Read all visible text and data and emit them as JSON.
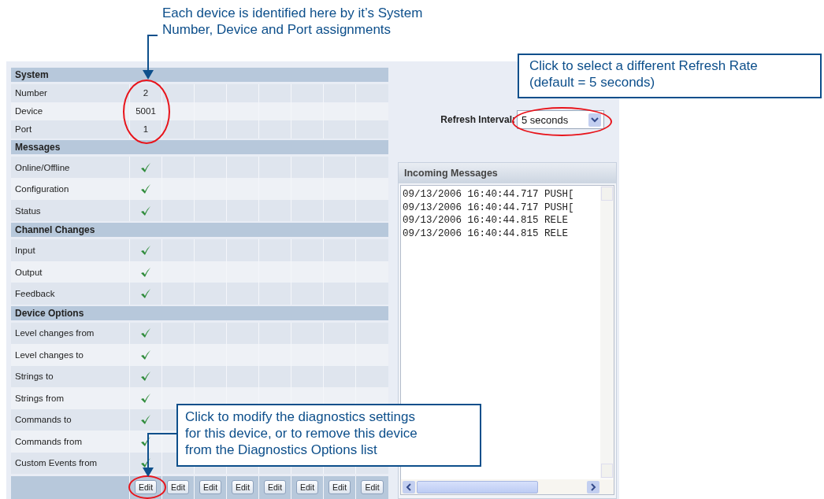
{
  "system": {
    "title": "System",
    "rows": [
      {
        "label": "Number",
        "value": "2"
      },
      {
        "label": "Device",
        "value": "5001"
      },
      {
        "label": "Port",
        "value": "1"
      }
    ]
  },
  "sections": [
    {
      "title": "Messages",
      "rows": [
        {
          "label": "Online/Offline",
          "checked": true
        },
        {
          "label": "Configuration",
          "checked": true
        },
        {
          "label": "Status",
          "checked": true
        }
      ]
    },
    {
      "title": "Channel Changes",
      "rows": [
        {
          "label": "Input",
          "checked": true
        },
        {
          "label": "Output",
          "checked": true
        },
        {
          "label": "Feedback",
          "checked": true
        }
      ]
    },
    {
      "title": "Device Options",
      "rows": [
        {
          "label": "Level changes from",
          "checked": true
        },
        {
          "label": "Level changes to",
          "checked": true
        },
        {
          "label": "Strings to",
          "checked": true
        },
        {
          "label": "Strings from",
          "checked": true
        },
        {
          "label": "Commands to",
          "checked": true
        },
        {
          "label": "Commands from",
          "checked": true
        },
        {
          "label": "Custom Events from",
          "checked": true
        }
      ]
    }
  ],
  "edit_buttons": [
    "Edit",
    "Edit",
    "Edit",
    "Edit",
    "Edit",
    "Edit",
    "Edit",
    "Edit"
  ],
  "refresh": {
    "label": "Refresh Interval:",
    "value": "5 seconds"
  },
  "incoming": {
    "title": "Incoming Messages",
    "lines": [
      "09/13/2006 16:40:44.717 PUSH[",
      "09/13/2006 16:40:44.717 PUSH[",
      "09/13/2006 16:40:44.815 RELE",
      "09/13/2006 16:40:44.815 RELE"
    ]
  },
  "callouts": [
    {
      "kind": "top",
      "lines": [
        "Each device is identified here by it’s System",
        "Number, Device and Port assignments"
      ]
    },
    {
      "kind": "right",
      "lines": [
        "Click to select a different Refresh Rate",
        "(default = 5 seconds)"
      ]
    },
    {
      "kind": "bottom",
      "lines": [
        "Click to modify the diagnostics settings",
        "for this device, or to remove this device",
        "from the Diagnostics Options list"
      ]
    }
  ]
}
